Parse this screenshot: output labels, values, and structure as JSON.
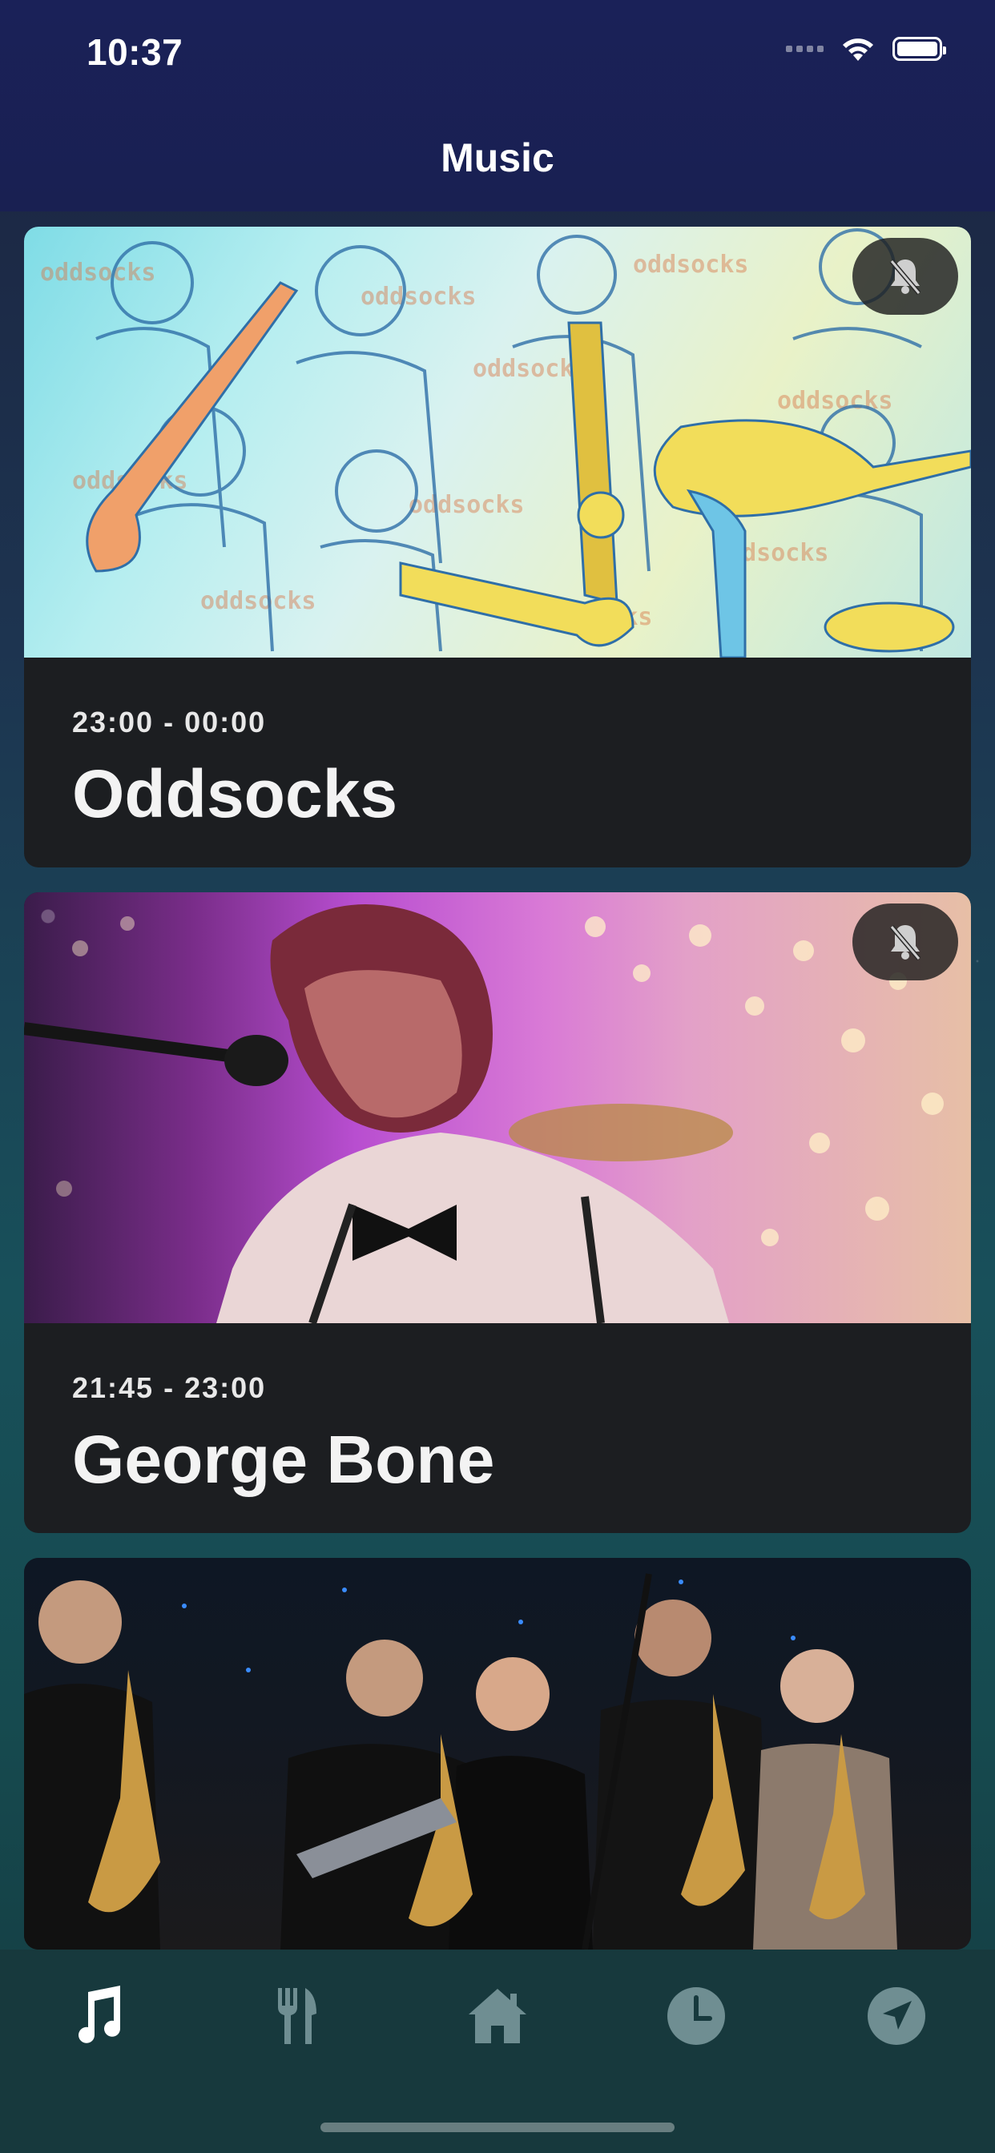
{
  "status_bar": {
    "time": "10:37"
  },
  "header": {
    "title": "Music"
  },
  "cards": [
    {
      "time": "23:00 - 00:00",
      "name": "Oddsocks",
      "image_text": "oddsocks"
    },
    {
      "time": "21:45 - 23:00",
      "name": "George Bone"
    },
    {
      "time": "",
      "name": ""
    }
  ],
  "tabs": [
    {
      "icon": "music-note-icon",
      "active": true
    },
    {
      "icon": "fork-knife-icon",
      "active": false
    },
    {
      "icon": "home-icon",
      "active": false
    },
    {
      "icon": "clock-icon",
      "active": false
    },
    {
      "icon": "location-arrow-icon",
      "active": false
    }
  ],
  "colors": {
    "tab_active": "#ffffff",
    "tab_inactive": "#6f8e92",
    "card_bg": "#1c1e21"
  }
}
